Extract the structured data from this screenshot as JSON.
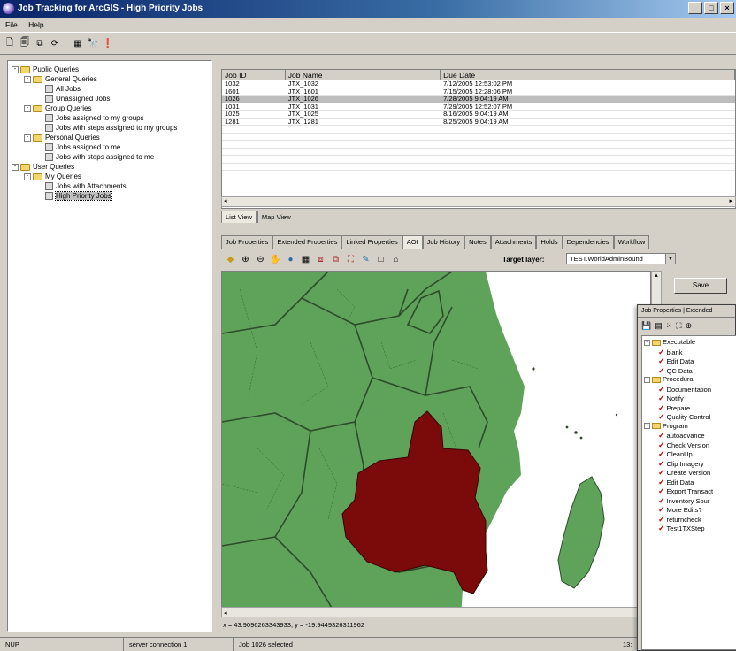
{
  "window": {
    "title": "Job Tracking for ArcGIS - High Priority Jobs",
    "buttons": [
      "_",
      "□",
      "×"
    ]
  },
  "menu": [
    "File",
    "Help"
  ],
  "tree": {
    "items": [
      {
        "label": "Public Queries",
        "level": 0,
        "kind": "folder",
        "expander": "-"
      },
      {
        "label": "General Queries",
        "level": 1,
        "kind": "folder",
        "expander": "-"
      },
      {
        "label": "All Jobs",
        "level": 2,
        "kind": "leaf"
      },
      {
        "label": "Unassigned Jobs",
        "level": 2,
        "kind": "leaf"
      },
      {
        "label": "Group Queries",
        "level": 1,
        "kind": "folder",
        "expander": "-"
      },
      {
        "label": "Jobs assigned to my groups",
        "level": 2,
        "kind": "leaf"
      },
      {
        "label": "Jobs with steps assigned to my groups",
        "level": 2,
        "kind": "leaf"
      },
      {
        "label": "Personal Queries",
        "level": 1,
        "kind": "folder",
        "expander": "-"
      },
      {
        "label": "Jobs assigned to me",
        "level": 2,
        "kind": "leaf"
      },
      {
        "label": "Jobs with steps assigned to me",
        "level": 2,
        "kind": "leaf"
      },
      {
        "label": "User Queries",
        "level": 0,
        "kind": "folder",
        "expander": "-"
      },
      {
        "label": "My Queries",
        "level": 1,
        "kind": "folder",
        "expander": "-"
      },
      {
        "label": "Jobs with Attachments",
        "level": 2,
        "kind": "leaf"
      },
      {
        "label": "High Priority Jobs",
        "level": 2,
        "kind": "leaf",
        "selected": true
      }
    ]
  },
  "grid": {
    "columns": [
      "Job ID",
      "Job Name",
      "Due Date"
    ],
    "rows": [
      [
        "1032",
        "JTX_1032",
        "7/12/2005 12:53:02 PM"
      ],
      [
        "1601",
        "JTX_1601",
        "7/15/2005 12:28:06 PM"
      ],
      [
        "1026",
        "JTX_1026",
        "7/28/2005 9:04:19 AM"
      ],
      [
        "1031",
        "JTX_1031",
        "7/29/2005 12:52:07 PM"
      ],
      [
        "1025",
        "JTX_1025",
        "8/16/2005 9:04:19 AM"
      ],
      [
        "1281",
        "JTX_1281",
        "8/25/2005 9:04:19 AM"
      ]
    ],
    "selected_row": 2
  },
  "view_tabs": [
    "List View",
    "Map View"
  ],
  "detail_tabs": [
    "Job Properties",
    "Extended Properties",
    "Linked Properties",
    "AOI",
    "Job History",
    "Notes",
    "Attachments",
    "Holds",
    "Dependencies",
    "Workflow"
  ],
  "active_detail_tab": "AOI",
  "aoi": {
    "target_label": "Target layer:",
    "target_value": "TEST.WorldAdminBound",
    "save_label": "Save",
    "coords": "x = 43.9096263343933, y = -19.9449326311962"
  },
  "status": [
    "NUP",
    "server connection 1",
    "Job 1026 selected",
    "13:"
  ],
  "overlay": {
    "tabs": "Job Properties | Extended",
    "items": [
      {
        "label": "Executable",
        "kind": "folder"
      },
      {
        "label": "blank",
        "kind": "step"
      },
      {
        "label": "Edit Data",
        "kind": "step"
      },
      {
        "label": "QC Data",
        "kind": "step"
      },
      {
        "label": "Procedural",
        "kind": "folder"
      },
      {
        "label": "Documentation",
        "kind": "step"
      },
      {
        "label": "Notify",
        "kind": "step"
      },
      {
        "label": "Prepare",
        "kind": "step"
      },
      {
        "label": "Quality Control",
        "kind": "step"
      },
      {
        "label": "Program",
        "kind": "folder"
      },
      {
        "label": "autoadvance",
        "kind": "step"
      },
      {
        "label": "Check Version",
        "kind": "step"
      },
      {
        "label": "CleanUp",
        "kind": "step"
      },
      {
        "label": "Clip Imagery",
        "kind": "step"
      },
      {
        "label": "Create Version",
        "kind": "step"
      },
      {
        "label": "Edit Data",
        "kind": "step"
      },
      {
        "label": "Export Transact",
        "kind": "step"
      },
      {
        "label": "Inventory Sour",
        "kind": "step"
      },
      {
        "label": "More Edits?",
        "kind": "step"
      },
      {
        "label": "returncheck",
        "kind": "step"
      },
      {
        "label": "Test1TXStep",
        "kind": "step"
      }
    ]
  },
  "colors": {
    "land": "#5fa35a",
    "aoi": "#7b0a0a",
    "border": "#2c4c2a",
    "water": "#ffffff"
  }
}
